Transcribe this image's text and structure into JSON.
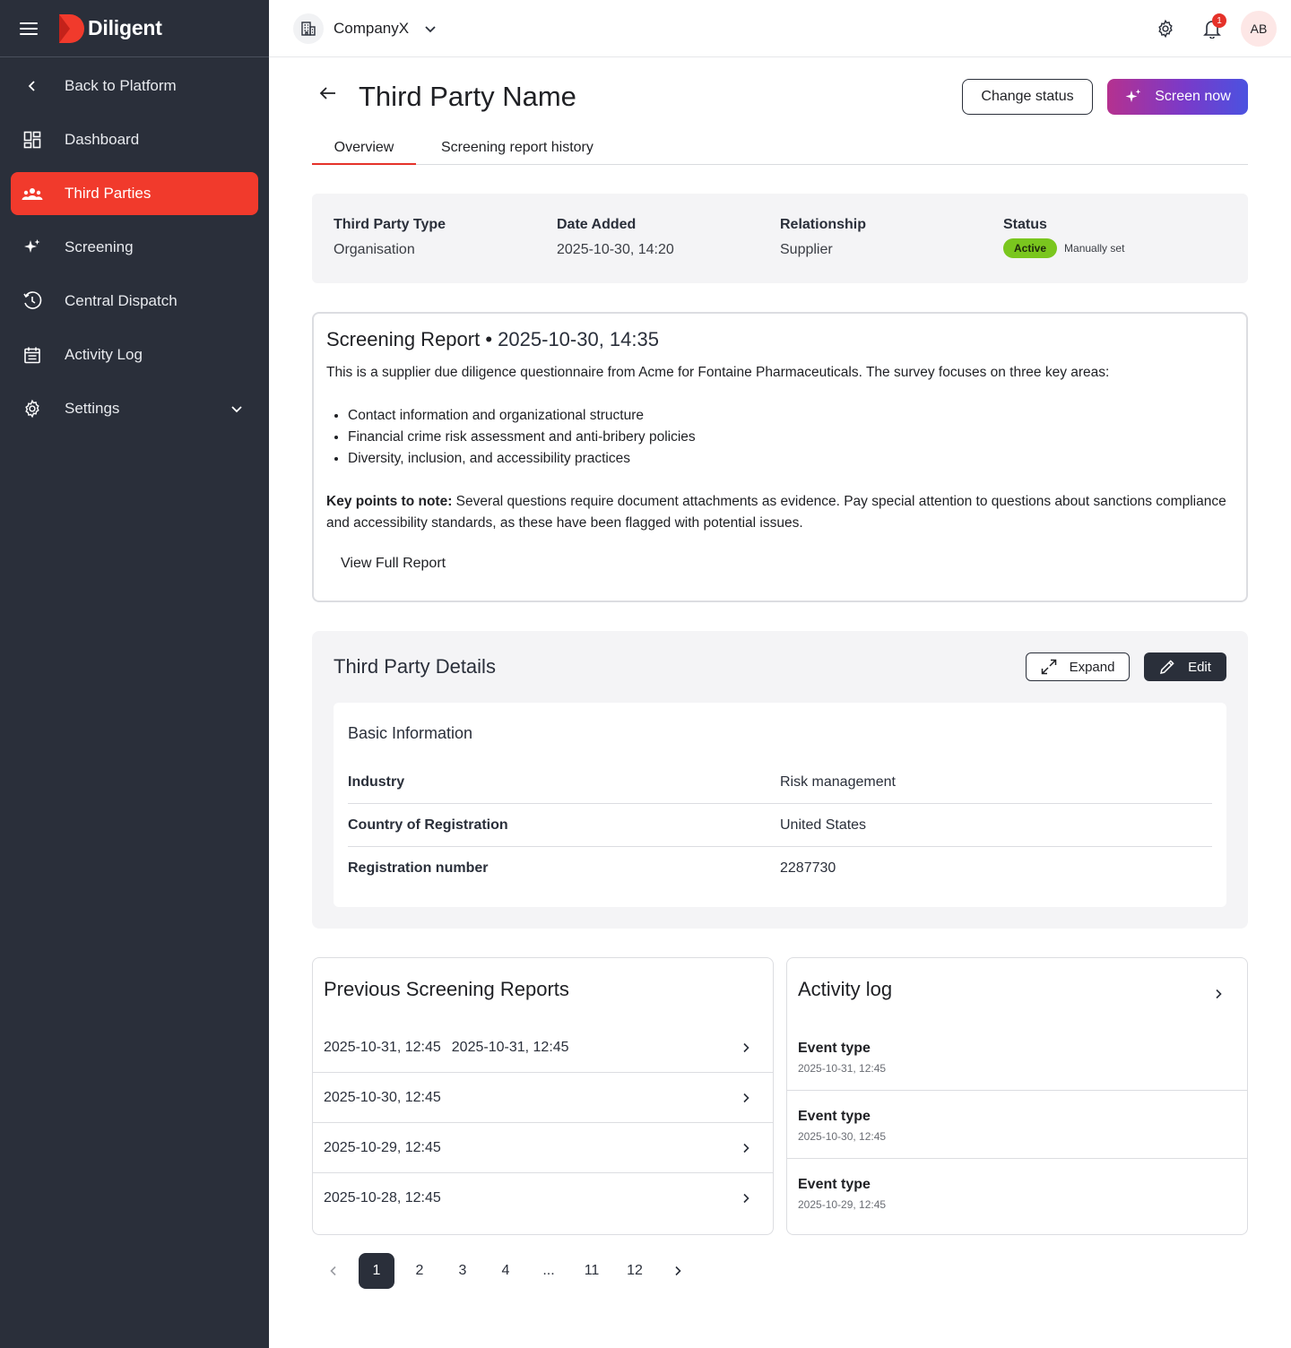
{
  "brand": {
    "name": "Diligent",
    "accent": "#f13a2c",
    "sidebar_bg": "#2a2f3a"
  },
  "sidebar": {
    "items": [
      {
        "label": "Back to Platform",
        "icon": "chevron-left-icon"
      },
      {
        "label": "Dashboard",
        "icon": "dashboard-icon"
      },
      {
        "label": "Third Parties",
        "icon": "people-icon",
        "active": true
      },
      {
        "label": "Screening",
        "icon": "sparkle-icon"
      },
      {
        "label": "Central Dispatch",
        "icon": "dispatch-icon"
      },
      {
        "label": "Activity Log",
        "icon": "calendar-log-icon"
      },
      {
        "label": "Settings",
        "icon": "gear-icon"
      }
    ]
  },
  "topbar": {
    "company": "CompanyX",
    "notifications": "1",
    "avatar_initials": "AB"
  },
  "page": {
    "title": "Third Party Name",
    "change_status": "Change status",
    "screen_now": "Screen now",
    "tabs": [
      "Overview",
      "Screening report history"
    ]
  },
  "summary": {
    "type_label": "Third Party Type",
    "type_value": "Organisation",
    "date_label": "Date Added",
    "date_value": "2025-10-30, 14:20",
    "relationship_label": "Relationship",
    "relationship_value": "Supplier",
    "status_label": "Status",
    "status_value": "Active",
    "status_note": "Manually set",
    "status_color": "#7ac61e"
  },
  "report": {
    "title": "Screening Report",
    "separator": "•",
    "datetime": "2025-10-30, 14:35",
    "intro": "This is a supplier due diligence questionnaire from Acme for Fontaine Pharmaceuticals. The survey focuses on three key areas:",
    "bullets": [
      "Contact information and organizational structure",
      "Financial crime risk assessment and anti-bribery policies",
      "Diversity, inclusion, and accessibility practices"
    ],
    "key_label": "Key points to note:",
    "key_text": "Several questions require document attachments as evidence. Pay special attention to questions about sanctions compliance and accessibility standards, as these have been flagged with potential issues.",
    "view_full": "View Full Report"
  },
  "details": {
    "title": "Third Party Details",
    "expand": "Expand",
    "edit": "Edit",
    "basic_title": "Basic Information",
    "rows": [
      {
        "k": "Industry",
        "v": "Risk management"
      },
      {
        "k": "Country of Registration",
        "v": "United States"
      },
      {
        "k": "Registration number",
        "v": "2287730"
      }
    ]
  },
  "previous_reports": {
    "title": "Previous Screening Reports",
    "rows": [
      {
        "left": "2025-10-31, 12:45",
        "right": "2025-10-31, 12:45"
      },
      {
        "left": "2025-10-30, 12:45",
        "right": ""
      },
      {
        "left": "2025-10-29, 12:45",
        "right": ""
      },
      {
        "left": "2025-10-28, 12:45",
        "right": ""
      }
    ]
  },
  "activity_log": {
    "title": "Activity log",
    "events": [
      {
        "type": "Event type",
        "date": "2025-10-31, 12:45"
      },
      {
        "type": "Event type",
        "date": "2025-10-30, 12:45"
      },
      {
        "type": "Event type",
        "date": "2025-10-29, 12:45"
      }
    ]
  },
  "pagination": {
    "pages": [
      "1",
      "2",
      "3",
      "4",
      "...",
      "11",
      "12"
    ],
    "current": "1"
  }
}
